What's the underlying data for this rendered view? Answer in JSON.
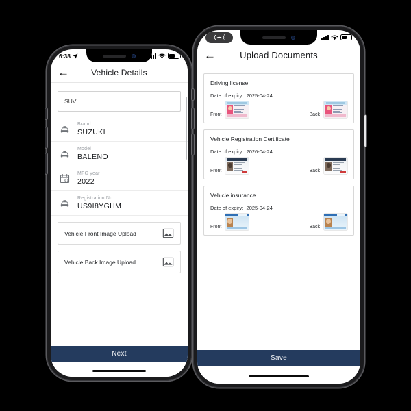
{
  "left_phone": {
    "status_bar": {
      "time": "6:38",
      "location_icon": "location-arrow-icon",
      "signal_icon": "cellular-signal-icon",
      "wifi_icon": "wifi-icon",
      "battery_icon": "battery-icon"
    },
    "header": {
      "back_icon": "back-arrow-icon",
      "title": "Vehicle Details"
    },
    "vehicle_type": {
      "value": "SUV"
    },
    "fields": [
      {
        "label": "Brand",
        "value": "SUZUKI",
        "icon": "car-icon"
      },
      {
        "label": "Model",
        "value": "BALENO",
        "icon": "car-icon"
      },
      {
        "label": "MFG year",
        "value": "2022",
        "icon": "calendar-icon"
      },
      {
        "label": "Registration No.",
        "value": "US9I8YGHM",
        "icon": "car-icon"
      }
    ],
    "uploads": [
      {
        "label": "Vehicle Front Image Upload",
        "icon": "image-upload-icon"
      },
      {
        "label": "Vehicle Back Image Upload",
        "icon": "image-upload-icon"
      }
    ],
    "action_button": {
      "label": "Next"
    }
  },
  "right_phone": {
    "status_bar": {
      "call_icon": "active-call-icon",
      "signal_icon": "cellular-signal-icon",
      "wifi_icon": "wifi-icon",
      "battery_icon": "battery-icon"
    },
    "header": {
      "back_icon": "back-arrow-icon",
      "title": "Upload Documents"
    },
    "documents": [
      {
        "title": "Driving license",
        "expiry_label": "Date of expiry:",
        "expiry_value": "2025-04-24",
        "front_label": "Front",
        "back_label": "Back",
        "thumb_style": "pink"
      },
      {
        "title": "Vehicle Registration Certificate",
        "expiry_label": "Date of expiry:",
        "expiry_value": "2026-04-24",
        "front_label": "Front",
        "back_label": "Back",
        "thumb_style": "grey"
      },
      {
        "title": "Vehicle insurance",
        "expiry_label": "Date of expiry:",
        "expiry_value": "2025-04-24",
        "front_label": "Front",
        "back_label": "Back",
        "thumb_style": "blue"
      }
    ],
    "action_button": {
      "label": "Save"
    }
  },
  "theme": {
    "accent_navy": "#243b5e",
    "background": "#000000",
    "screen_white": "#ffffff"
  }
}
